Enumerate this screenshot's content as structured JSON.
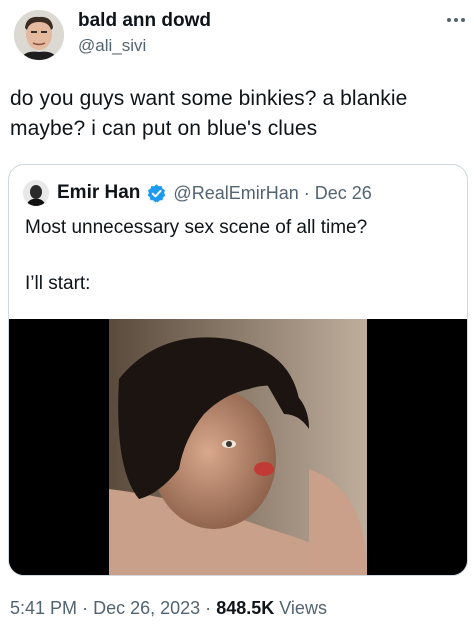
{
  "author": {
    "display_name": "bald ann dowd",
    "handle": "@ali_sivi"
  },
  "tweet": {
    "text_line1": "do you guys want some binkies? a blankie",
    "text_line2": "maybe? i can put on blue's clues"
  },
  "quoted": {
    "display_name": "Emir Han",
    "handle": "@RealEmirHan",
    "separator": "·",
    "date": "Dec 26",
    "text_line1": "Most unnecessary sex scene of all time?",
    "text_line2": "I’ll start:"
  },
  "meta": {
    "time": "5:41 PM",
    "sep1": "·",
    "date": "Dec 26, 2023",
    "sep2": "·",
    "views_count": "848.5K",
    "views_label": "Views"
  },
  "colors": {
    "verified": "#1d9bf0",
    "secondary_text": "#536471",
    "border": "#cfd9de"
  },
  "icons": [
    "more-icon",
    "verified-badge-icon"
  ]
}
